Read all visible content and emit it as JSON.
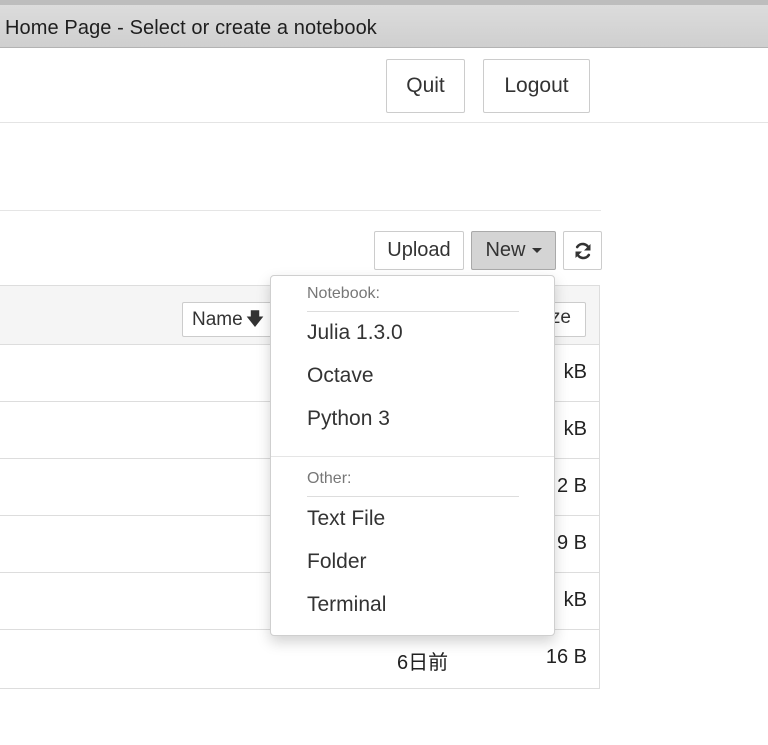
{
  "window": {
    "title": "Home Page - Select or create a notebook"
  },
  "header": {
    "quit_label": "Quit",
    "logout_label": "Logout"
  },
  "toolbar": {
    "upload_label": "Upload",
    "new_label": "New",
    "refresh_icon": "refresh-icon"
  },
  "list": {
    "header": {
      "name_label": "Name",
      "name_sort_icon": "arrow-down-icon",
      "size_label_visible": "ze"
    },
    "rows": [
      {
        "modified": "",
        "size": "kB"
      },
      {
        "modified": "",
        "size": "kB"
      },
      {
        "modified": "",
        "size": "2 B"
      },
      {
        "modified": "",
        "size": "9 B"
      },
      {
        "modified": "",
        "size": "kB"
      },
      {
        "modified": "6日前",
        "size": "16 B"
      }
    ]
  },
  "new_menu": {
    "notebook_header": "Notebook:",
    "notebook_items": [
      "Julia 1.3.0",
      "Octave",
      "Python 3"
    ],
    "other_header": "Other:",
    "other_items": [
      "Text File",
      "Folder",
      "Terminal"
    ]
  }
}
